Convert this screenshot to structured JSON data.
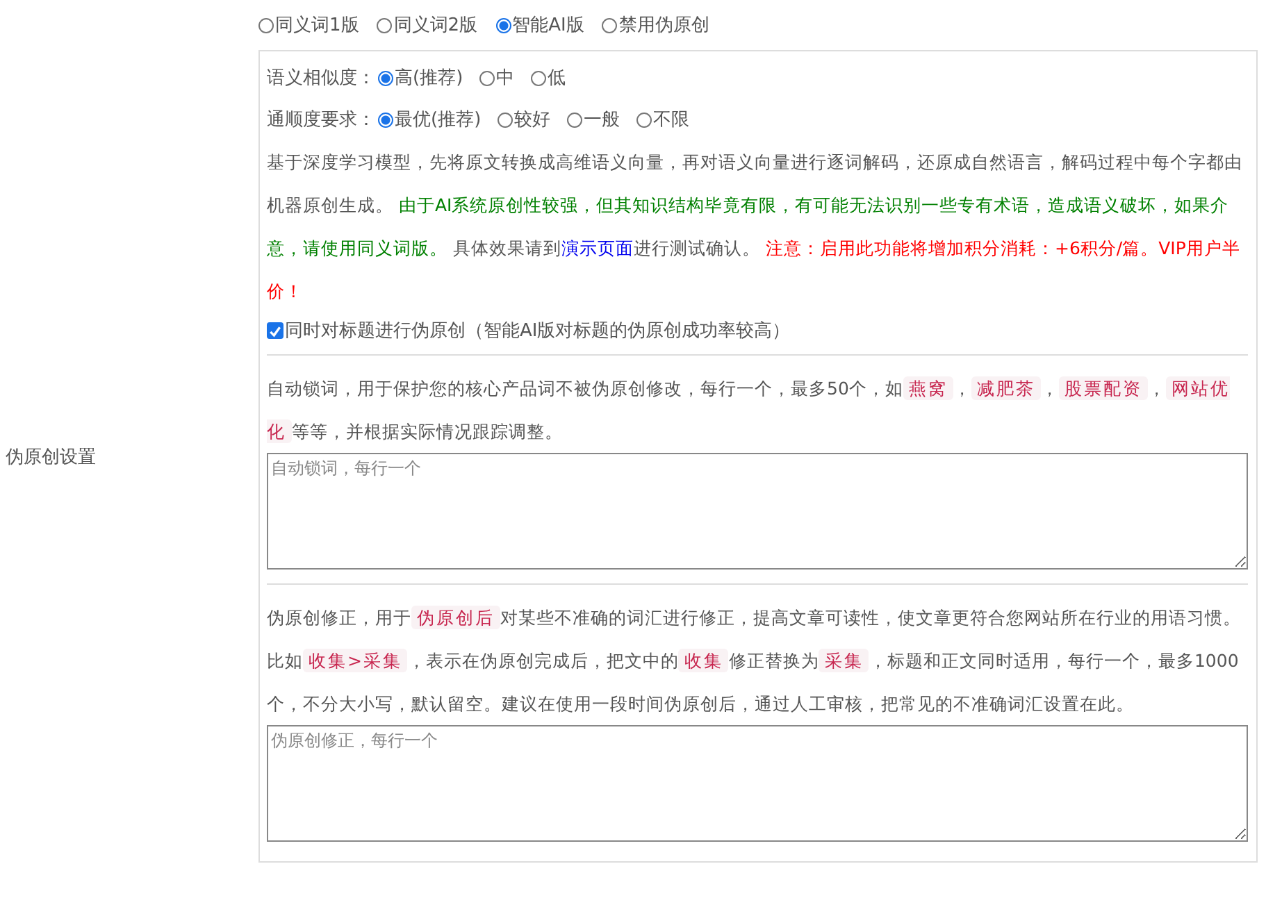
{
  "section_label": "伪原创设置",
  "modes": [
    {
      "label": "同义词1版",
      "selected": false
    },
    {
      "label": "同义词2版",
      "selected": false
    },
    {
      "label": "智能AI版",
      "selected": true
    },
    {
      "label": "禁用伪原创",
      "selected": false
    }
  ],
  "option_groups": [
    {
      "label": "语义相似度：",
      "options": [
        {
          "label": "高(推荐)",
          "selected": true
        },
        {
          "label": "中",
          "selected": false
        },
        {
          "label": "低",
          "selected": false
        }
      ]
    },
    {
      "label": "通顺度要求：",
      "options": [
        {
          "label": "最优(推荐)",
          "selected": true
        },
        {
          "label": "较好",
          "selected": false
        },
        {
          "label": "一般",
          "selected": false
        },
        {
          "label": "不限",
          "selected": false
        }
      ]
    }
  ],
  "ai_description": [
    {
      "kind": "plain",
      "text": "基于深度学习模型，先将原文转换成高维语义向量，再对语义向量进行逐词解码，还原成自然语言，解码过程中每个字都由机器原创生成。 "
    },
    {
      "kind": "notice",
      "text": "由于AI系统原创性较强，但其知识结构毕竟有限，有可能无法识别一些专有术语，造成语义破坏，如果介意，请使用同义词版。"
    },
    {
      "kind": "plain",
      "text": " 具体效果请到"
    },
    {
      "kind": "link",
      "text": "演示页面"
    },
    {
      "kind": "plain",
      "text": "进行测试确认。 "
    },
    {
      "kind": "warning",
      "text": "注意：启用此功能将增加积分消耗：+6积分/篇。VIP用户半价！"
    }
  ],
  "title_option": {
    "label": "同时对标题进行伪原创（智能AI版对标题的伪原创成功率较高）",
    "checked": true
  },
  "lock_words": {
    "description": [
      {
        "kind": "plain",
        "text": "自动锁词，用于保护您的核心产品词不被伪原创修改，每行一个，最多50个，如"
      },
      {
        "kind": "code",
        "text": "燕窝"
      },
      {
        "kind": "plain",
        "text": "，"
      },
      {
        "kind": "code",
        "text": "减肥茶"
      },
      {
        "kind": "plain",
        "text": "，"
      },
      {
        "kind": "code",
        "text": "股票配资"
      },
      {
        "kind": "plain",
        "text": "，"
      },
      {
        "kind": "code",
        "text": "网站优化"
      },
      {
        "kind": "plain",
        "text": "等等，并根据实际情况跟踪调整。"
      }
    ],
    "placeholder": "自动锁词，每行一个"
  },
  "corrections": {
    "description": [
      {
        "kind": "plain",
        "text": "伪原创修正，用于"
      },
      {
        "kind": "code",
        "text": "伪原创后"
      },
      {
        "kind": "plain",
        "text": "对某些不准确的词汇进行修正，提高文章可读性，使文章更符合您网站所在行业的用语习惯。比如"
      },
      {
        "kind": "code",
        "text": "收集>采集"
      },
      {
        "kind": "plain",
        "text": "，表示在伪原创完成后，把文中的"
      },
      {
        "kind": "code",
        "text": "收集"
      },
      {
        "kind": "plain",
        "text": "修正替换为"
      },
      {
        "kind": "code",
        "text": "采集"
      },
      {
        "kind": "plain",
        "text": "，标题和正文同时适用，每行一个，最多1000个，不分大小写，默认留空。建议在使用一段时间伪原创后，通过人工审核，把常见的不准确词汇设置在此。"
      }
    ],
    "placeholder": "伪原创修正，每行一个"
  }
}
